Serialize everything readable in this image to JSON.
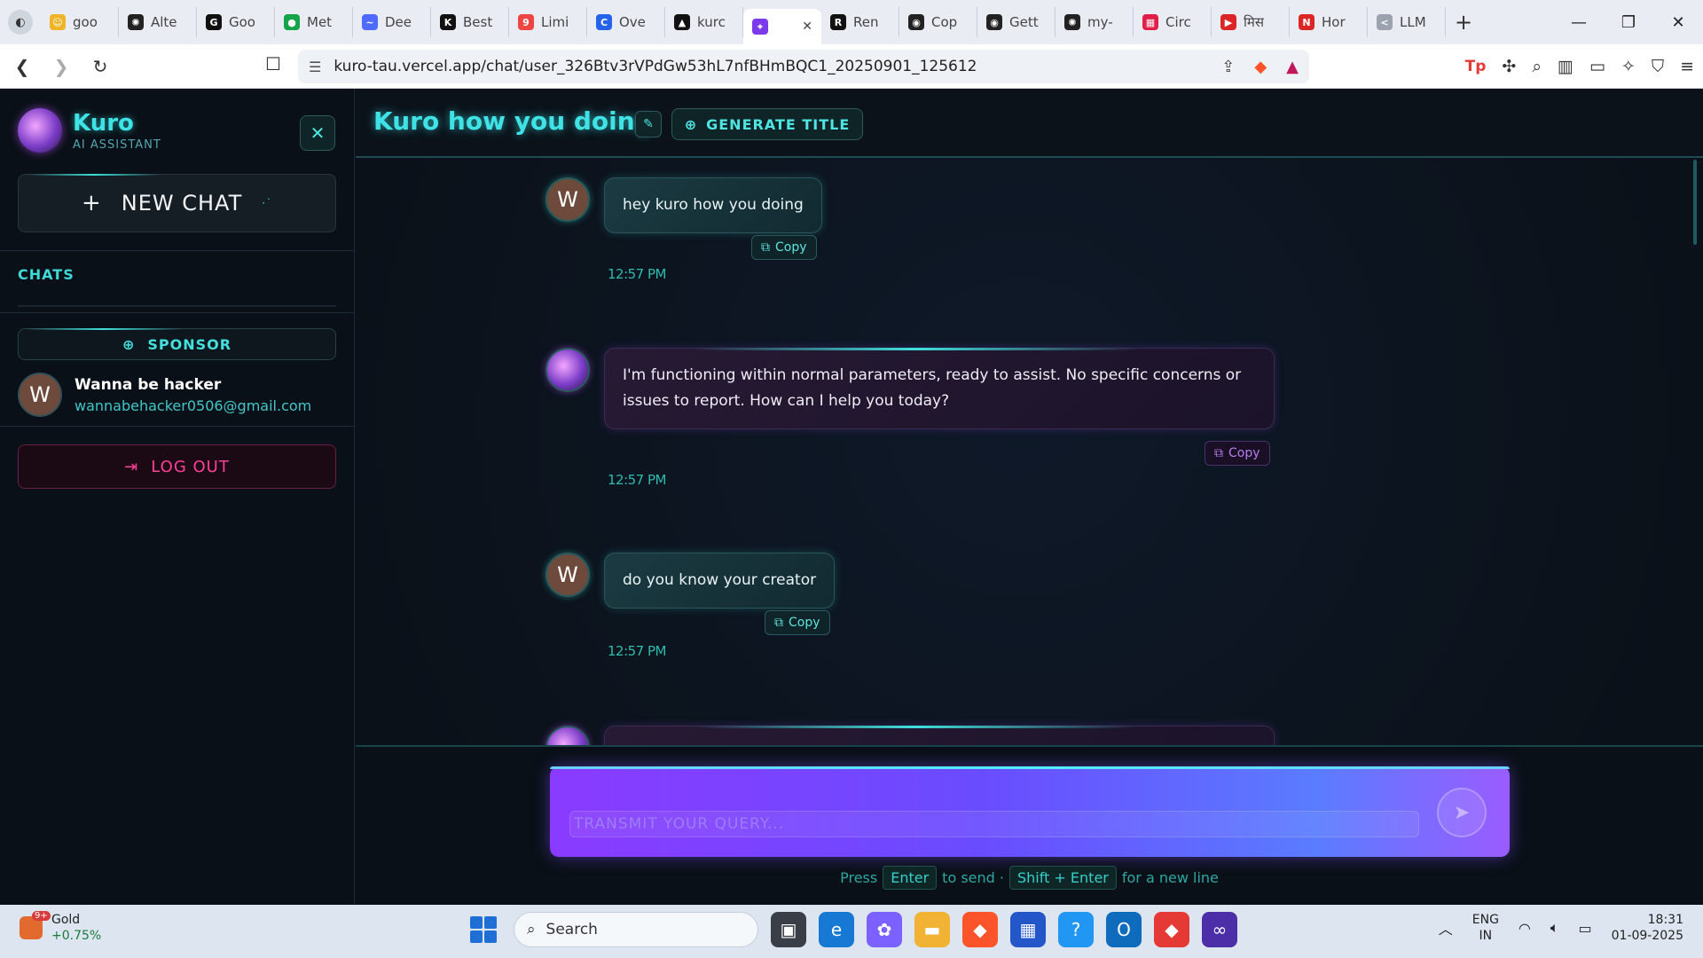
{
  "browser": {
    "tabs": [
      {
        "title": "goo",
        "color": "#f0b429",
        "glyph": "☺"
      },
      {
        "title": "Alte",
        "color": "#222222",
        "glyph": "✺"
      },
      {
        "title": "Goo",
        "color": "#111111",
        "glyph": "G"
      },
      {
        "title": "Met",
        "color": "#16a34a",
        "glyph": "●"
      },
      {
        "title": "Dee",
        "color": "#4f6bff",
        "glyph": "~"
      },
      {
        "title": "Best",
        "color": "#111111",
        "glyph": "K"
      },
      {
        "title": "Limi",
        "color": "#ef4444",
        "glyph": "9"
      },
      {
        "title": "Ove",
        "color": "#2563eb",
        "glyph": "C"
      },
      {
        "title": "kurc",
        "color": "#111111",
        "glyph": "▲"
      },
      {
        "title": "",
        "color": "#7c3aed",
        "glyph": "✦"
      },
      {
        "title": "Ren",
        "color": "#111111",
        "glyph": "R"
      },
      {
        "title": "Cop",
        "color": "#222222",
        "glyph": "◉"
      },
      {
        "title": "Gett",
        "color": "#222222",
        "glyph": "◉"
      },
      {
        "title": "my-",
        "color": "#222222",
        "glyph": "✺"
      },
      {
        "title": "Circ",
        "color": "#e11d48",
        "glyph": "▦"
      },
      {
        "title": "मिस",
        "color": "#dc2626",
        "glyph": "▶"
      },
      {
        "title": "Hor",
        "color": "#dc2626",
        "glyph": "N"
      },
      {
        "title": "LLM",
        "color": "#9ca3af",
        "glyph": "<"
      }
    ],
    "url_host": "kuro-tau.vercel.app",
    "url_path": "/chat/user_326Btv3rVPdGw53hL7nfBHmBQC1_20250901_125612"
  },
  "sidebar": {
    "brand_name": "Kuro",
    "brand_sub": "AI ASSISTANT",
    "new_chat_label": "NEW CHAT",
    "chats_label": "CHATS",
    "sponsor_label": "SPONSOR",
    "user": {
      "initial": "W",
      "name": "Wanna be hacker",
      "email": "wannabehacker0506@gmail.com"
    },
    "logout_label": "LOG OUT"
  },
  "chat": {
    "title": "Kuro how you doing",
    "generate_title_label": "GENERATE TITLE",
    "copy_label": "Copy",
    "messages": [
      {
        "role": "user",
        "initial": "W",
        "text": "hey kuro how you doing",
        "time": "12:57 PM"
      },
      {
        "role": "assistant",
        "text": "I'm functioning within normal parameters, ready to assist. No specific concerns or issues to report. How can I help you today?",
        "time": "12:57 PM"
      },
      {
        "role": "user",
        "initial": "W",
        "text": "do you know your creator",
        "time": "12:57 PM"
      }
    ],
    "input_placeholder": "TRANSMIT YOUR QUERY...",
    "hint": {
      "press": "Press",
      "enter": "Enter",
      "to_send": "to send ·",
      "shift_enter": "Shift + Enter",
      "new_line": "for a new line"
    }
  },
  "taskbar": {
    "weather_name": "Gold",
    "weather_change": "+0.75%",
    "weather_badge": "9+",
    "search_label": "Search",
    "lang_line1": "ENG",
    "lang_line2": "IN",
    "time": "18:31",
    "date": "01-09-2025"
  },
  "colors": {
    "accent_cyan": "#3fe3e6",
    "logout_pink": "#ff3f9a",
    "composer_purple": "#8a3bff"
  }
}
